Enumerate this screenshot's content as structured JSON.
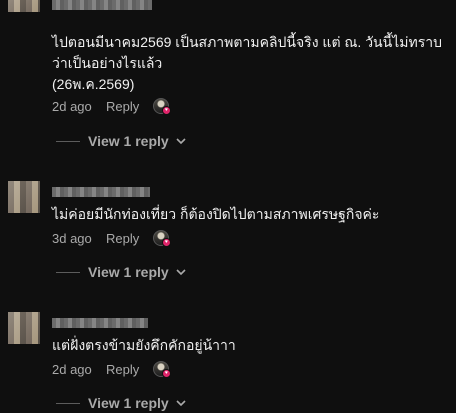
{
  "comments": [
    {
      "text": "ไปตอนมีนาคม2569 เป็นสภาพตามคลิปนี้จริง แต่ ณ. วันนี้ไม่ทราบ\nว่าเป็นอย่างไรแล้ว\n(26พ.ค.2569)",
      "time": "2d ago",
      "reply_label": "Reply",
      "view_replies_label": "View 1 reply"
    },
    {
      "text": "ไม่ค่อยมีนักท่องเที่ยว ก็ต้องปิดไปตามสภาพเศรษฐกิจค่ะ",
      "time": "3d ago",
      "reply_label": "Reply",
      "view_replies_label": "View 1 reply"
    },
    {
      "text": "แต่ฝั่งตรงข้ามยังคึกคักอยู่น้าาา",
      "time": "2d ago",
      "reply_label": "Reply",
      "view_replies_label": "View 1 reply"
    }
  ],
  "colors": {
    "background": "#0f0f0f",
    "text_primary": "#f1f1f1",
    "text_secondary": "#aaaaaa",
    "heart_badge": "#e0246a"
  },
  "icons": {
    "creator_heart": "heart-icon",
    "expand": "chevron-down-icon"
  }
}
